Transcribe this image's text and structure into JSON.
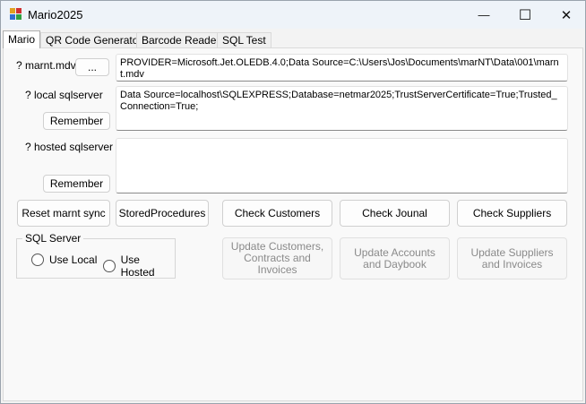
{
  "window": {
    "title": "Mario2025",
    "controls": {
      "minimize": "—",
      "maximize": "☐",
      "close": "✕"
    }
  },
  "tabs": [
    {
      "label": "Mario",
      "active": true
    },
    {
      "label": "QR Code Generator",
      "active": false
    },
    {
      "label": "Barcode Reader",
      "active": false
    },
    {
      "label": "SQL Test",
      "active": false
    }
  ],
  "mdv": {
    "label": "? marnt.mdv",
    "browse_label": "...",
    "value": "PROVIDER=Microsoft.Jet.OLEDB.4.0;Data Source=C:\\Users\\Jos\\Documents\\marNT\\Data\\001\\marnt.mdv"
  },
  "local": {
    "label": "? local sqlserver",
    "remember_label": "Remember",
    "value": "Data Source=localhost\\SQLEXPRESS;Database=netmar2025;TrustServerCertificate=True;Trusted_Connection=True;"
  },
  "hosted": {
    "label": "? hosted sqlserver",
    "remember_label": "Remember",
    "value": ""
  },
  "actions": {
    "reset": "Reset marnt sync",
    "stored_procedures": "StoredProcedures",
    "check_customers": "Check Customers",
    "check_journal": "Check Jounal",
    "check_suppliers": "Check Suppliers"
  },
  "sql_server": {
    "title": "SQL Server",
    "use_local": "Use Local",
    "use_hosted": "Use Hosted"
  },
  "updates": {
    "customers": "Update Customers, Contracts and Invoices",
    "accounts": "Update Accounts and Daybook",
    "suppliers": "Update Suppliers and Invoices"
  },
  "colors": {
    "titlebar": "#eef3f9",
    "tabpage": "#f9f9f9",
    "disabled_text": "#8a8a8a"
  }
}
